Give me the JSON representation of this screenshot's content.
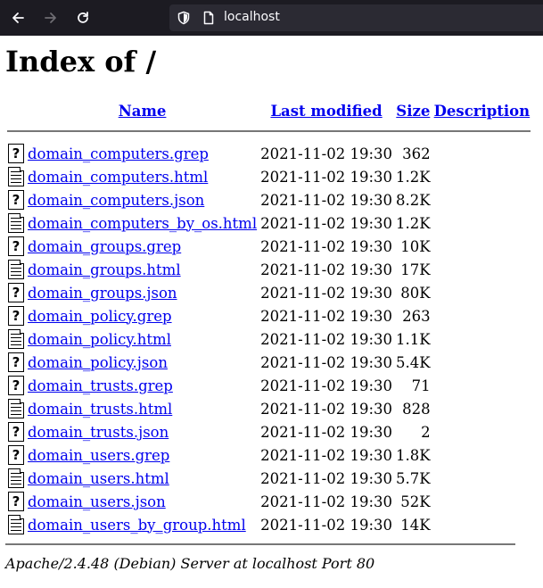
{
  "browser": {
    "url": "localhost"
  },
  "page": {
    "heading": "Index of /",
    "columns": {
      "name": "Name",
      "modified": "Last modified",
      "size": "Size",
      "description": "Description"
    },
    "files": [
      {
        "icon": "unknown-file-icon",
        "name": "domain_computers.grep",
        "modified": "2021-11-02 19:30",
        "size": "362",
        "description": ""
      },
      {
        "icon": "text-file-icon",
        "name": "domain_computers.html",
        "modified": "2021-11-02 19:30",
        "size": "1.2K",
        "description": ""
      },
      {
        "icon": "unknown-file-icon",
        "name": "domain_computers.json",
        "modified": "2021-11-02 19:30",
        "size": "8.2K",
        "description": ""
      },
      {
        "icon": "text-file-icon",
        "name": "domain_computers_by_os.html",
        "modified": "2021-11-02 19:30",
        "size": "1.2K",
        "description": ""
      },
      {
        "icon": "unknown-file-icon",
        "name": "domain_groups.grep",
        "modified": "2021-11-02 19:30",
        "size": "10K",
        "description": ""
      },
      {
        "icon": "text-file-icon",
        "name": "domain_groups.html",
        "modified": "2021-11-02 19:30",
        "size": "17K",
        "description": ""
      },
      {
        "icon": "unknown-file-icon",
        "name": "domain_groups.json",
        "modified": "2021-11-02 19:30",
        "size": "80K",
        "description": ""
      },
      {
        "icon": "unknown-file-icon",
        "name": "domain_policy.grep",
        "modified": "2021-11-02 19:30",
        "size": "263",
        "description": ""
      },
      {
        "icon": "text-file-icon",
        "name": "domain_policy.html",
        "modified": "2021-11-02 19:30",
        "size": "1.1K",
        "description": ""
      },
      {
        "icon": "unknown-file-icon",
        "name": "domain_policy.json",
        "modified": "2021-11-02 19:30",
        "size": "5.4K",
        "description": ""
      },
      {
        "icon": "unknown-file-icon",
        "name": "domain_trusts.grep",
        "modified": "2021-11-02 19:30",
        "size": "71",
        "description": ""
      },
      {
        "icon": "text-file-icon",
        "name": "domain_trusts.html",
        "modified": "2021-11-02 19:30",
        "size": "828",
        "description": ""
      },
      {
        "icon": "unknown-file-icon",
        "name": "domain_trusts.json",
        "modified": "2021-11-02 19:30",
        "size": "2",
        "description": ""
      },
      {
        "icon": "unknown-file-icon",
        "name": "domain_users.grep",
        "modified": "2021-11-02 19:30",
        "size": "1.8K",
        "description": ""
      },
      {
        "icon": "text-file-icon",
        "name": "domain_users.html",
        "modified": "2021-11-02 19:30",
        "size": "5.7K",
        "description": ""
      },
      {
        "icon": "unknown-file-icon",
        "name": "domain_users.json",
        "modified": "2021-11-02 19:30",
        "size": "52K",
        "description": ""
      },
      {
        "icon": "text-file-icon",
        "name": "domain_users_by_group.html",
        "modified": "2021-11-02 19:30",
        "size": "14K",
        "description": ""
      }
    ],
    "footer": "Apache/2.4.48 (Debian) Server at localhost Port 80"
  }
}
